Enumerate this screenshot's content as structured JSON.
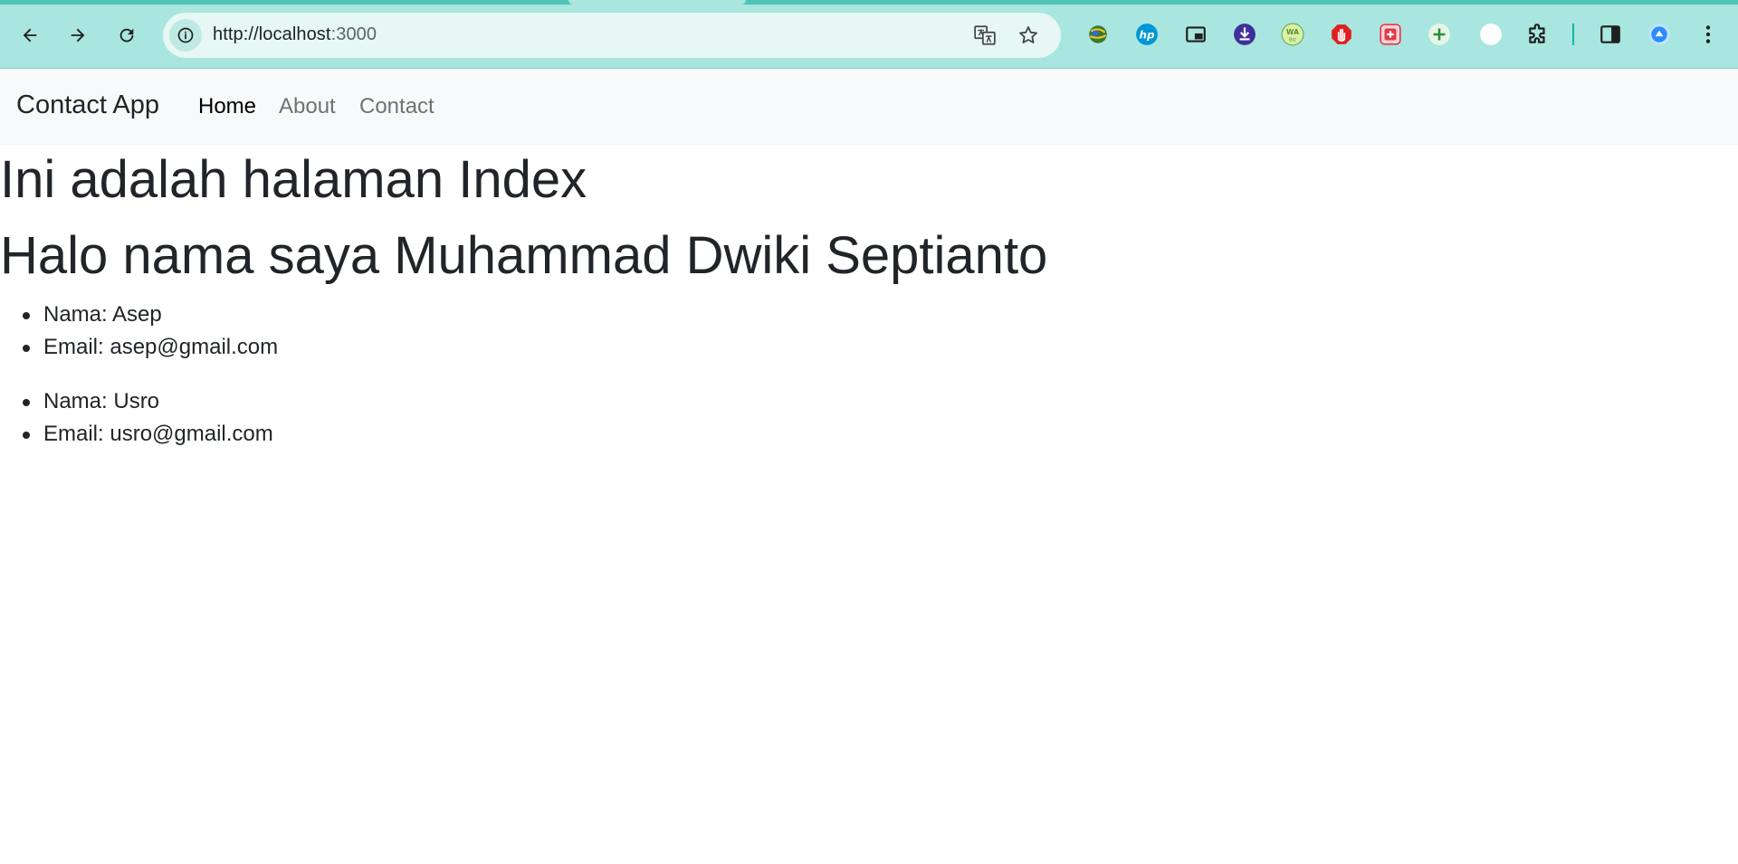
{
  "browser": {
    "url_host": "http://localhost",
    "url_rest": ":3000",
    "toolbar_icons": [
      "back-icon",
      "forward-icon",
      "reload-icon",
      "site-info-icon",
      "translate-icon",
      "bookmark-star-icon"
    ],
    "extension_icons": [
      "globe-extension-icon",
      "hp-extension-icon",
      "picture-in-picture-icon",
      "download-extension-icon",
      "wa-blaster-extension-icon",
      "stop-hand-extension-icon",
      "red-plus-extension-icon",
      "green-plus-extension-icon",
      "profile-circle-icon",
      "extensions-puzzle-icon",
      "side-panel-icon",
      "blue-avatar-icon",
      "more-menu-icon"
    ]
  },
  "navbar": {
    "brand": "Contact App",
    "links": [
      {
        "label": "Home",
        "active": true
      },
      {
        "label": "About",
        "active": false
      },
      {
        "label": "Contact",
        "active": false
      }
    ]
  },
  "main": {
    "title": "Ini adalah halaman Index",
    "greeting": "Halo nama saya Muhammad Dwiki Septianto",
    "contacts": [
      {
        "nama": "Nama: Asep",
        "email": "Email: asep@gmail.com"
      },
      {
        "nama": "Nama: Usro",
        "email": "Email: usro@gmail.com"
      }
    ]
  },
  "colors": {
    "chrome_bg": "#a8e6df",
    "navbar_bg": "#f8f9fa",
    "text": "#212529"
  }
}
